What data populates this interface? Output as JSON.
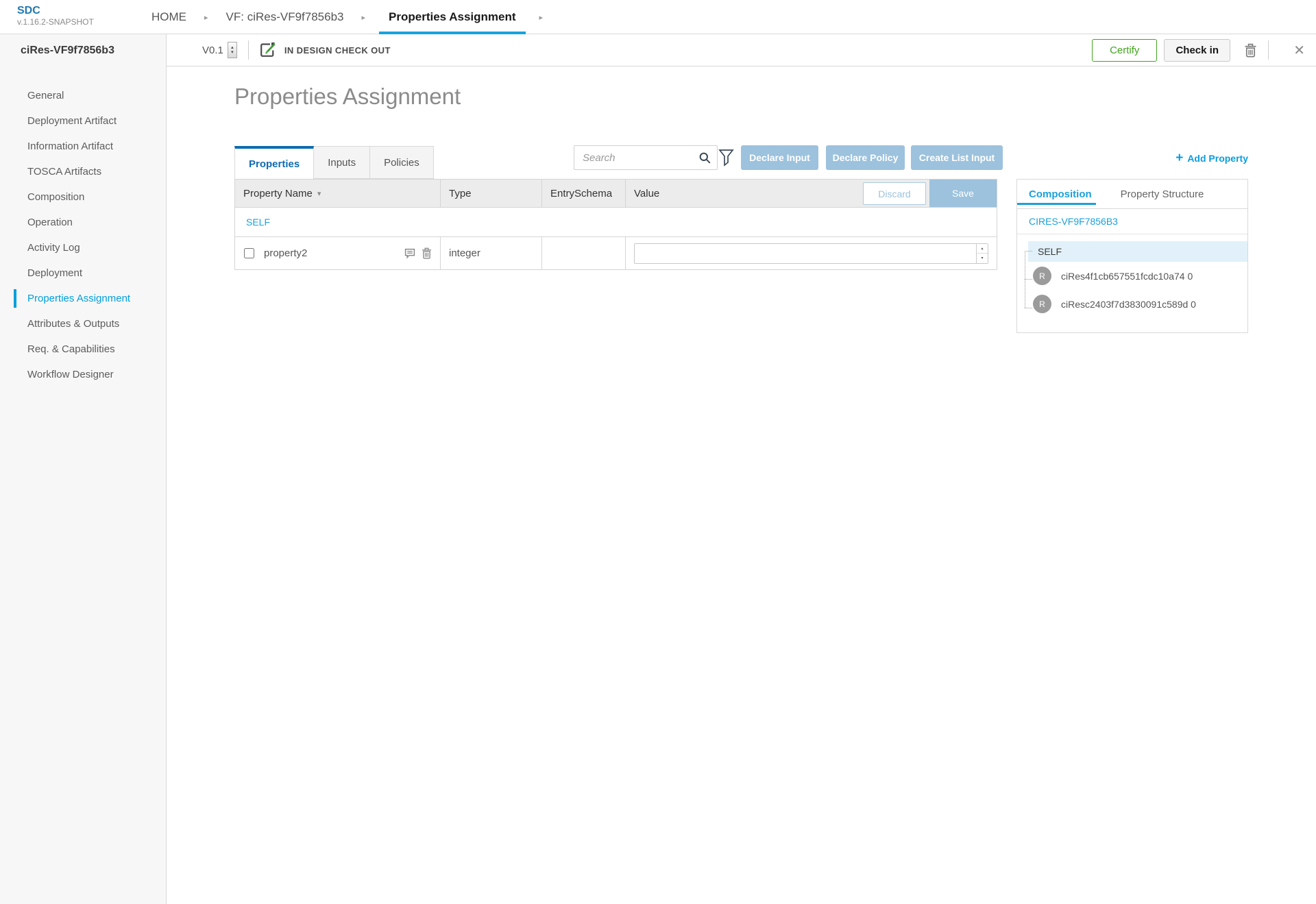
{
  "app": {
    "name": "SDC",
    "version": "v.1.16.2-SNAPSHOT"
  },
  "nav": {
    "separator": "▸",
    "breadcrumbs": [
      {
        "label": "HOME"
      },
      {
        "label": "VF: ciRes-VF9f7856b3"
      },
      {
        "label": "Properties Assignment",
        "active": true
      }
    ]
  },
  "workspace": {
    "entity_name": "ciRes-VF9f7856b3",
    "version_label": "V0.1",
    "lifecycle_status": "IN DESIGN CHECK OUT",
    "certify_label": "Certify",
    "check_in_label": "Check in",
    "close_glyph": "✕"
  },
  "sidebar": {
    "items": [
      {
        "label": "General"
      },
      {
        "label": "Deployment Artifact"
      },
      {
        "label": "Information Artifact"
      },
      {
        "label": "TOSCA Artifacts"
      },
      {
        "label": "Composition"
      },
      {
        "label": "Operation"
      },
      {
        "label": "Activity Log"
      },
      {
        "label": "Deployment"
      },
      {
        "label": "Properties Assignment",
        "active": true
      },
      {
        "label": "Attributes & Outputs"
      },
      {
        "label": "Req. & Capabilities"
      },
      {
        "label": "Workflow Designer"
      }
    ]
  },
  "main": {
    "title": "Properties Assignment",
    "tabs": [
      {
        "label": "Properties",
        "active": true
      },
      {
        "label": "Inputs"
      },
      {
        "label": "Policies"
      }
    ],
    "search_placeholder": "Search",
    "declare_input_label": "Declare Input",
    "declare_policy_label": "Declare Policy",
    "create_list_input_label": "Create List Input",
    "add_property": {
      "plus": "+",
      "label": "Add Property"
    },
    "table": {
      "columns": [
        "Property Name",
        "Type",
        "EntrySchema",
        "Value"
      ],
      "sort_glyph": "▾",
      "discard_label": "Discard",
      "save_label": "Save",
      "group_label": "SELF",
      "rows": [
        {
          "name": "property2",
          "type": "integer",
          "entry_schema": "",
          "value": ""
        }
      ]
    }
  },
  "right_panel": {
    "tabs": [
      {
        "label": "Composition",
        "active": true
      },
      {
        "label": "Property Structure"
      }
    ],
    "root_label": "CIRES-VF9F7856B3",
    "tree": {
      "self_label": "SELF",
      "items": [
        {
          "avatar_initial": "R",
          "label": "ciRes4f1cb657551fcdc10a74 0"
        },
        {
          "avatar_initial": "R",
          "label": "ciResc2403f7d3830091c589d 0"
        }
      ]
    }
  },
  "icons": {
    "spinner_up": "▴",
    "spinner_down": "▾"
  },
  "colors": {
    "accent_blue": "#009fdb",
    "deep_tab_blue": "#0e6cb0",
    "link_blue": "#1ba3dc",
    "underline_blue": "#16a3dc",
    "button_blue": "#9cc2dd",
    "certify_green": "#42a51f",
    "sidebar_bg": "#f7f7f7",
    "table_header_bg": "#ececec",
    "selected_tree_row": "#e2f1f9"
  }
}
